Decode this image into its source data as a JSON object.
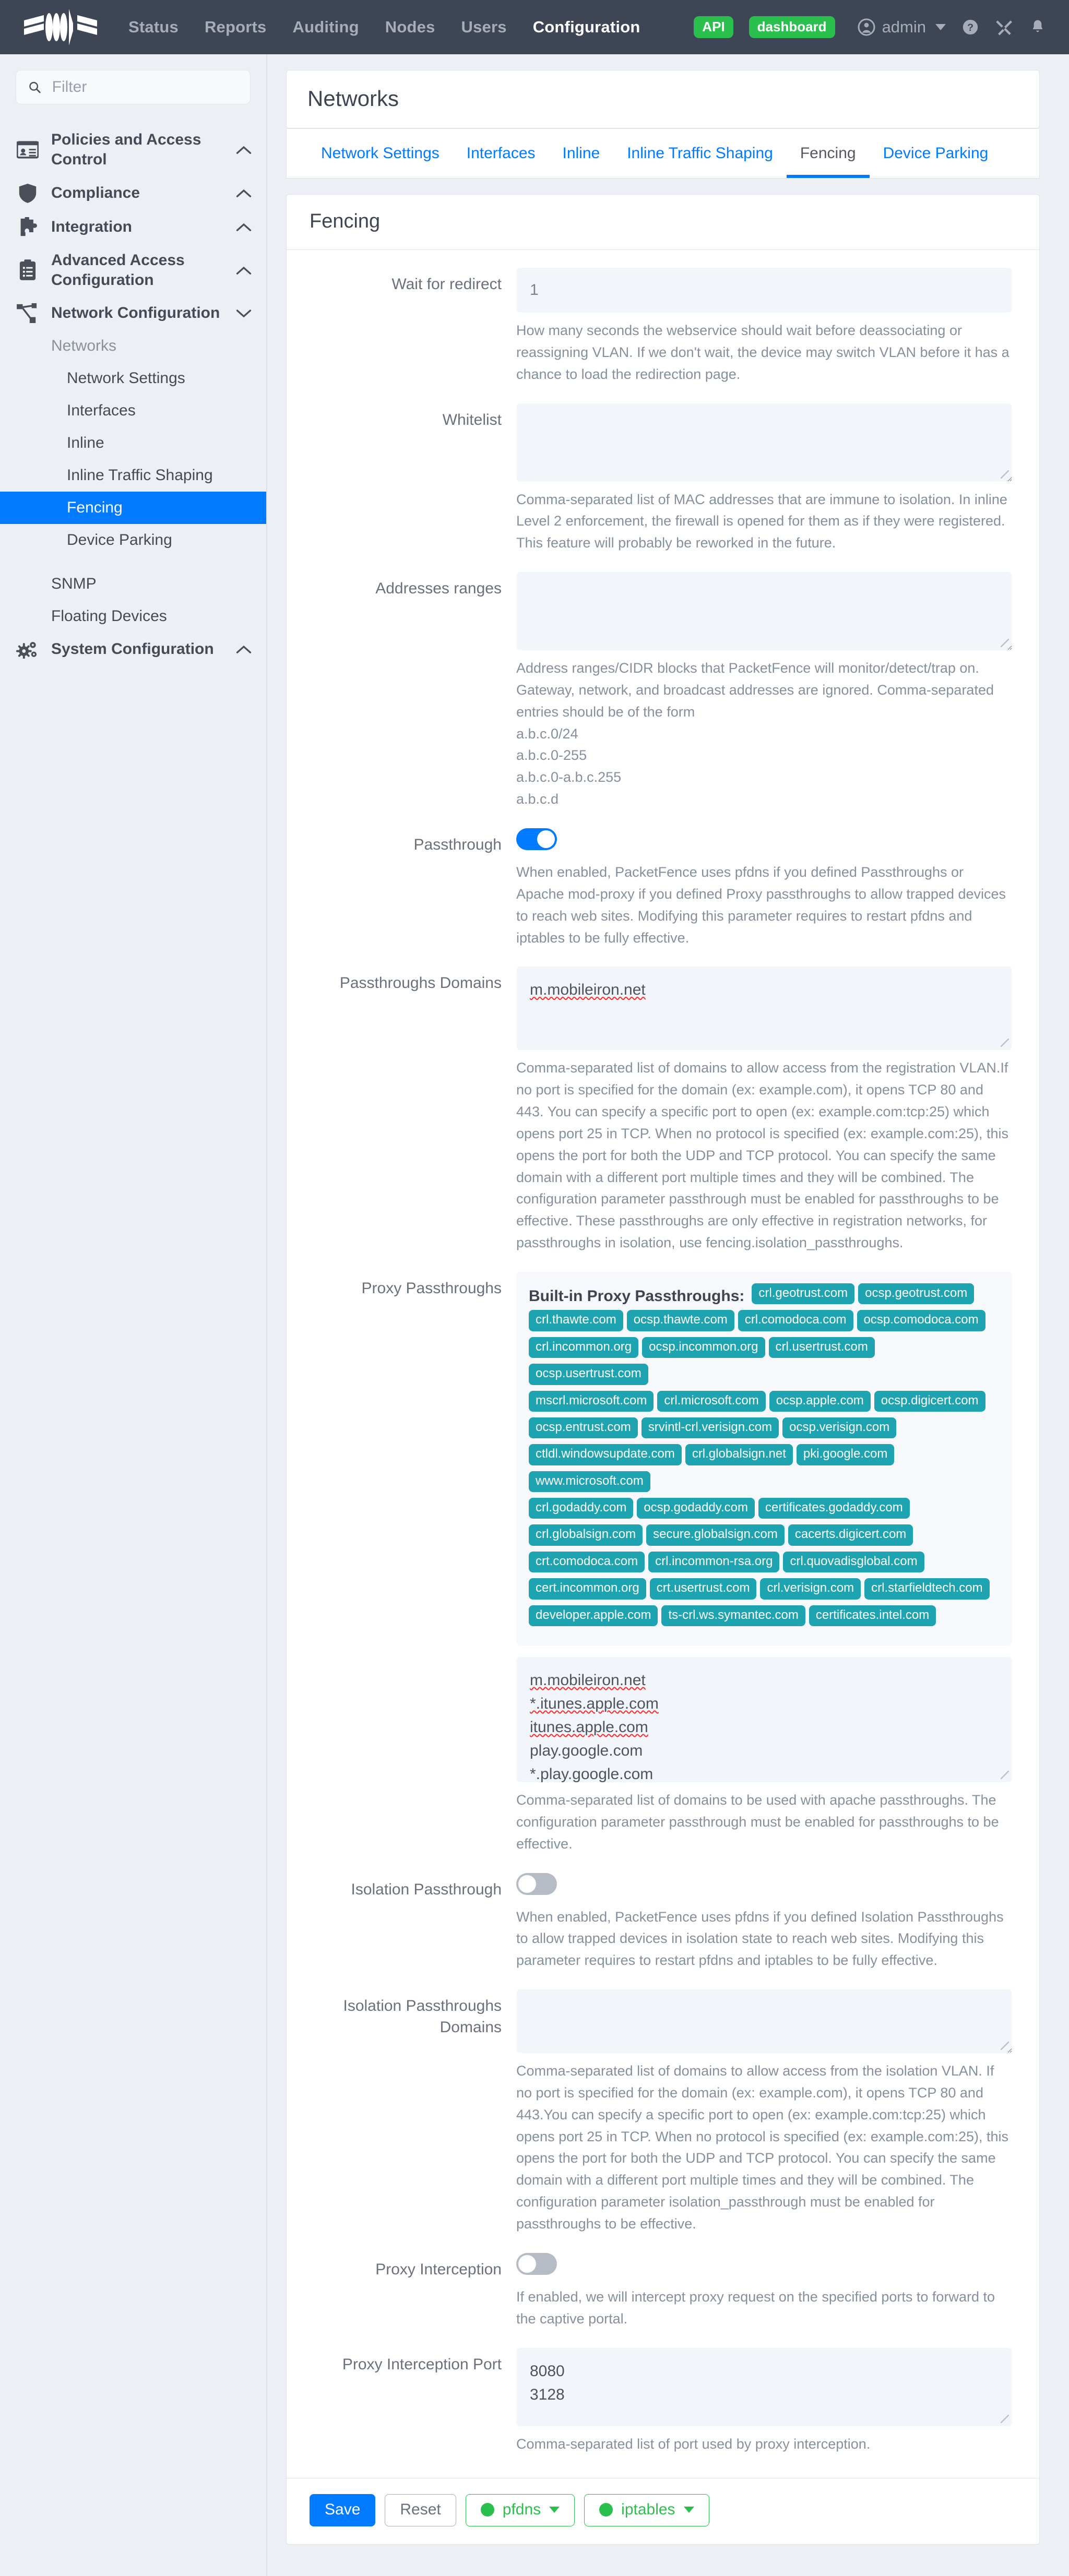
{
  "topnav": {
    "logo_name": "packetfence-logo",
    "links": [
      {
        "label": "Status",
        "active": false
      },
      {
        "label": "Reports",
        "active": false
      },
      {
        "label": "Auditing",
        "active": false
      },
      {
        "label": "Nodes",
        "active": false
      },
      {
        "label": "Users",
        "active": false
      },
      {
        "label": "Configuration",
        "active": true
      }
    ],
    "api_pill": "API",
    "dashboard_pill": "dashboard",
    "user": "admin",
    "accent_green": "#2bbf4e",
    "bar_color": "#3e4655"
  },
  "sidebar": {
    "filter_placeholder": "Filter",
    "groups": [
      {
        "label": "Policies and Access Control",
        "icon": "id-card-icon",
        "chevron": "up"
      },
      {
        "label": "Compliance",
        "icon": "shield-icon",
        "chevron": "up"
      },
      {
        "label": "Integration",
        "icon": "puzzle-icon",
        "chevron": "up"
      },
      {
        "label": "Advanced Access Configuration",
        "icon": "clipboard-icon",
        "chevron": "up"
      },
      {
        "label": "Network Configuration",
        "icon": "sitemap-icon",
        "chevron": "down"
      }
    ],
    "networks_header": "Networks",
    "network_items": [
      {
        "label": "Network Settings",
        "active": false
      },
      {
        "label": "Interfaces",
        "active": false
      },
      {
        "label": "Inline",
        "active": false
      },
      {
        "label": "Inline Traffic Shaping",
        "active": false
      },
      {
        "label": "Fencing",
        "active": true
      },
      {
        "label": "Device Parking",
        "active": false
      }
    ],
    "plain_items": [
      {
        "label": "SNMP"
      },
      {
        "label": "Floating Devices"
      }
    ],
    "system_config": {
      "label": "System Configuration",
      "icon": "gears-icon",
      "chevron": "up"
    },
    "active_color": "#007bff"
  },
  "page": {
    "title": "Networks",
    "tabs": [
      {
        "label": "Network Settings",
        "active": false
      },
      {
        "label": "Interfaces",
        "active": false
      },
      {
        "label": "Inline",
        "active": false
      },
      {
        "label": "Inline Traffic Shaping",
        "active": false
      },
      {
        "label": "Fencing",
        "active": true
      },
      {
        "label": "Device Parking",
        "active": false
      }
    ],
    "card_title": "Fencing"
  },
  "form": {
    "wait_for_redirect": {
      "label": "Wait for redirect",
      "value": "1",
      "help": "How many seconds the webservice should wait before deassociating or reassigning VLAN. If we don't wait, the device may switch VLAN before it has a chance to load the redirection page."
    },
    "whitelist": {
      "label": "Whitelist",
      "value": "",
      "help": "Comma-separated list of MAC addresses that are immune to isolation. In inline Level 2 enforcement, the firewall is opened for them as if they were registered. This feature will probably be reworked in the future."
    },
    "addresses_ranges": {
      "label": "Addresses ranges",
      "value": "",
      "help_intro": "Address ranges/CIDR blocks that PacketFence will monitor/detect/trap on. Gateway, network, and broadcast addresses are ignored. Comma-separated entries should be of the form",
      "help_lines": [
        "a.b.c.0/24",
        "a.b.c.0-255",
        "a.b.c.0-a.b.c.255",
        "a.b.c.d"
      ]
    },
    "passthrough": {
      "label": "Passthrough",
      "enabled": true,
      "help": "When enabled, PacketFence uses pfdns if you defined Passthroughs or Apache mod-proxy if you defined Proxy passthroughs to allow trapped devices to reach web sites. Modifying this parameter requires to restart pfdns and iptables to be fully effective."
    },
    "passthroughs_domains": {
      "label": "Passthroughs Domains",
      "value": "m.mobileiron.net",
      "misspelled": [
        "m.mobileiron.net"
      ],
      "help": "Comma-separated list of domains to allow access from the registration VLAN.If no port is specified for the domain (ex: example.com), it opens TCP 80 and 443. You can specify a specific port to open (ex: example.com:tcp:25) which opens port 25 in TCP. When no protocol is specified (ex: example.com:25), this opens the port for both the UDP and TCP protocol. You can specify the same domain with a different port multiple times and they will be combined. The configuration parameter passthrough must be enabled for passthroughs to be effective. These passthroughs are only effective in registration networks, for passthroughs in isolation, use fencing.isolation_passthroughs."
    },
    "proxy_passthroughs": {
      "label": "Proxy Passthroughs",
      "builtin_title": "Built-in Proxy Passthroughs:",
      "badges": [
        "crl.geotrust.com",
        "ocsp.geotrust.com",
        "crl.thawte.com",
        "ocsp.thawte.com",
        "crl.comodoca.com",
        "ocsp.comodoca.com",
        "crl.incommon.org",
        "ocsp.incommon.org",
        "crl.usertrust.com",
        "ocsp.usertrust.com",
        "mscrl.microsoft.com",
        "crl.microsoft.com",
        "ocsp.apple.com",
        "ocsp.digicert.com",
        "ocsp.entrust.com",
        "srvintl-crl.verisign.com",
        "ocsp.verisign.com",
        "ctldl.windowsupdate.com",
        "crl.globalsign.net",
        "pki.google.com",
        "www.microsoft.com",
        "crl.godaddy.com",
        "ocsp.godaddy.com",
        "certificates.godaddy.com",
        "crl.globalsign.com",
        "secure.globalsign.com",
        "cacerts.digicert.com",
        "crt.comodoca.com",
        "crl.incommon-rsa.org",
        "crl.quovadisglobal.com",
        "cert.incommon.org",
        "crt.usertrust.com",
        "crl.verisign.com",
        "crl.starfieldtech.com",
        "developer.apple.com",
        "ts-crl.ws.symantec.com",
        "certificates.intel.com"
      ],
      "badge_color": "#1ea3b0",
      "value_lines": [
        "m.mobileiron.net",
        "*.itunes.apple.com",
        "itunes.apple.com",
        "play.google.com",
        "*.play.google.com"
      ],
      "misspelled_lines": [
        "m.mobileiron.net",
        "*.itunes.apple.com",
        "itunes.apple.com"
      ],
      "help": "Comma-separated list of domains to be used with apache passthroughs. The configuration parameter passthrough must be enabled for passthroughs to be effective."
    },
    "isolation_passthrough": {
      "label": "Isolation Passthrough",
      "enabled": false,
      "help": "When enabled, PacketFence uses pfdns if you defined Isolation Passthroughs to allow trapped devices in isolation state to reach web sites. Modifying this parameter requires to restart pfdns and iptables to be fully effective."
    },
    "isolation_passthroughs_domains": {
      "label": "Isolation Passthroughs Domains",
      "value": "",
      "help": "Comma-separated list of domains to allow access from the isolation VLAN. If no port is specified for the domain (ex: example.com), it opens TCP 80 and 443.You can specify a specific port to open (ex: example.com:tcp:25) which opens port 25 in TCP. When no protocol is specified (ex: example.com:25), this opens the port for both the UDP and TCP protocol. You can specify the same domain with a different port multiple times and they will be combined. The configuration parameter isolation_passthrough must be enabled for passthroughs to be effective."
    },
    "proxy_interception": {
      "label": "Proxy Interception",
      "enabled": false,
      "help": "If enabled, we will intercept proxy request on the specified ports to forward to the captive portal."
    },
    "proxy_interception_port": {
      "label": "Proxy Interception Port",
      "value_lines": [
        "8080",
        "3128"
      ],
      "help": "Comma-separated list of port used by proxy interception."
    }
  },
  "footer": {
    "save": "Save",
    "reset": "Reset",
    "services": [
      {
        "label": "pfdns",
        "status_color": "#2bbf4e"
      },
      {
        "label": "iptables",
        "status_color": "#2bbf4e"
      }
    ]
  }
}
